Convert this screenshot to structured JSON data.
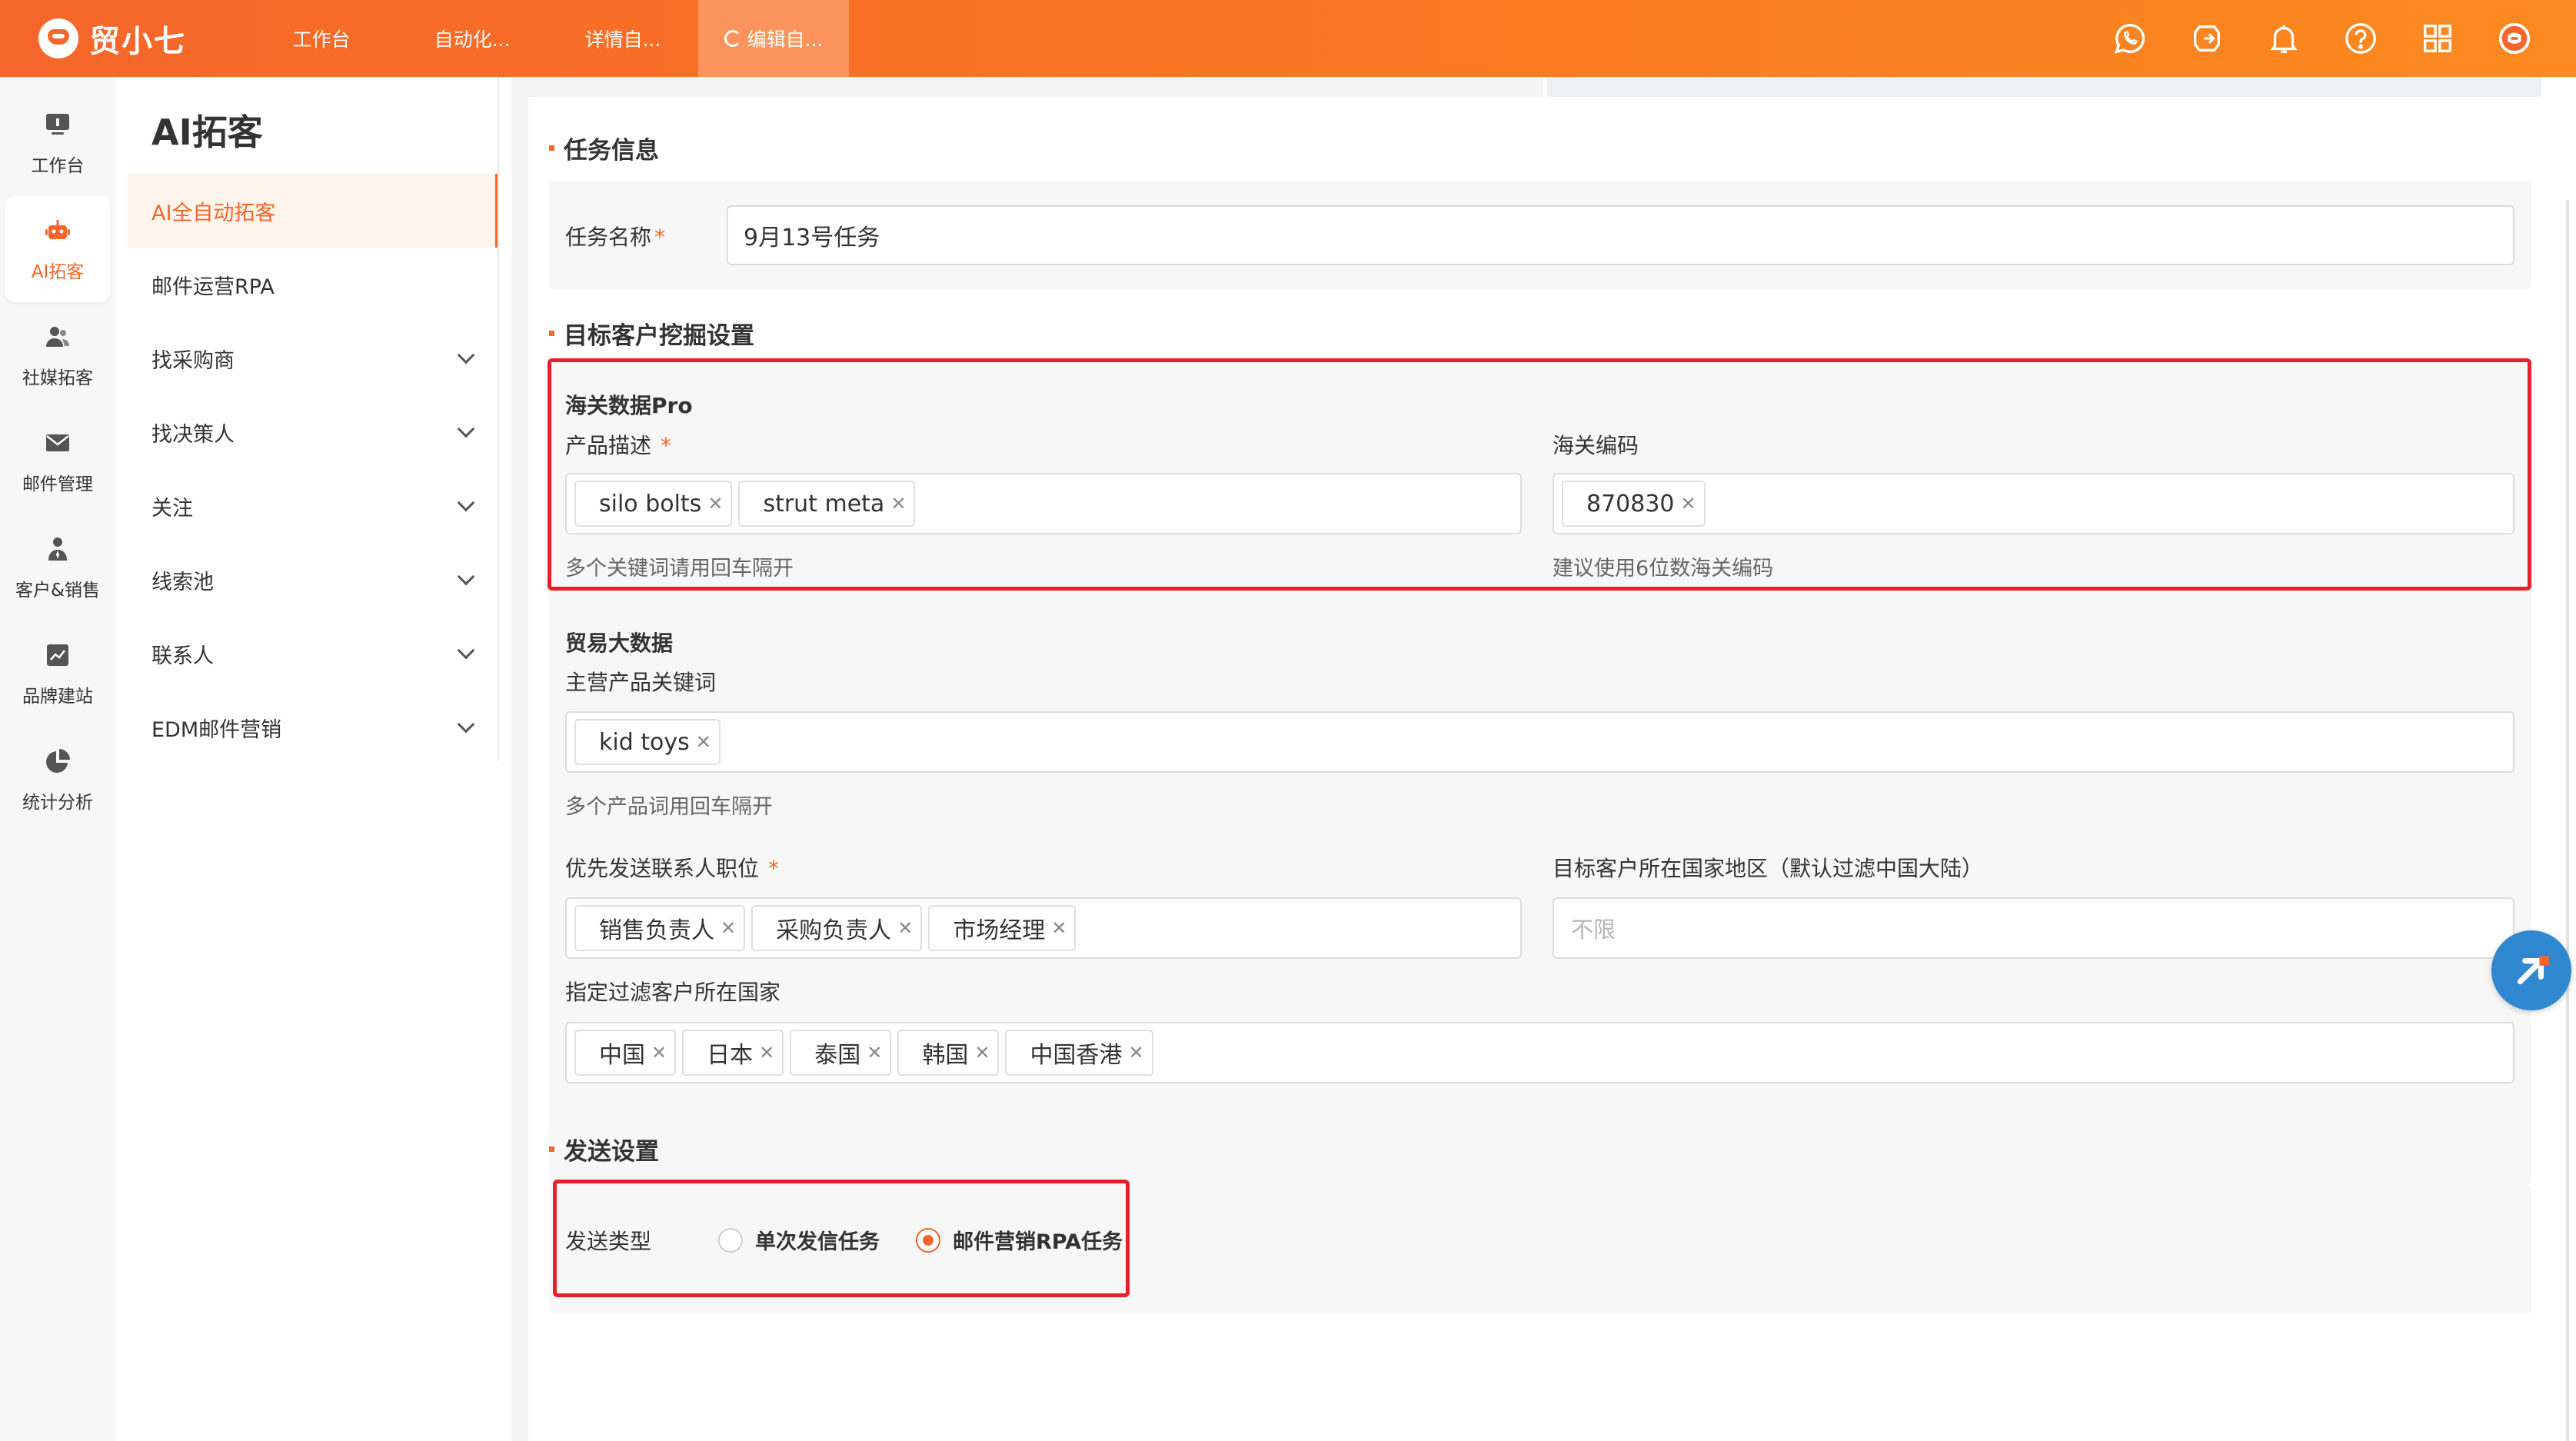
{
  "app": {
    "name": "贸小七"
  },
  "top_tabs": [
    {
      "label": "工作台"
    },
    {
      "label": "自动化..."
    },
    {
      "label": "详情自..."
    },
    {
      "label": "编辑自..."
    }
  ],
  "top_icons": [
    "whatsapp-icon",
    "share-icon",
    "bell-icon",
    "help-icon",
    "apps-grid-icon",
    "user-avatar-icon"
  ],
  "rail": [
    {
      "label": "工作台",
      "icon": "monitor-icon"
    },
    {
      "label": "AI拓客",
      "icon": "robot-icon"
    },
    {
      "label": "社媒拓客",
      "icon": "users-icon"
    },
    {
      "label": "邮件管理",
      "icon": "mail-icon"
    },
    {
      "label": "客户&销售",
      "icon": "person-icon"
    },
    {
      "label": "品牌建站",
      "icon": "chart-board-icon"
    },
    {
      "label": "统计分析",
      "icon": "pie-chart-icon"
    }
  ],
  "subnav": {
    "title": "AI拓客",
    "items": [
      {
        "label": "AI全自动拓客"
      },
      {
        "label": "邮件运营RPA"
      },
      {
        "label": "找采购商"
      },
      {
        "label": "找决策人"
      },
      {
        "label": "关注"
      },
      {
        "label": "线索池"
      },
      {
        "label": "联系人"
      },
      {
        "label": "EDM邮件营销"
      }
    ]
  },
  "task_info": {
    "section_title": "任务信息",
    "name_label": "任务名称",
    "required_mark": "*",
    "name_value": "9月13号任务"
  },
  "target": {
    "section_title": "目标客户挖掘设置",
    "customs": {
      "title": "海关数据Pro",
      "product_label": "产品描述",
      "product_tags": [
        "silo bolts",
        "strut meta"
      ],
      "product_hint": "多个关键词请用回车隔开",
      "hs_label": "海关编码",
      "hs_tags": [
        "870830"
      ],
      "hs_hint": "建议使用6位数海关编码"
    },
    "trade": {
      "title": "贸易大数据",
      "keywords_label": "主营产品关键词",
      "keywords_tags": [
        "kid toys"
      ],
      "keywords_hint": "多个产品词用回车隔开"
    },
    "positions_label": "优先发送联系人职位",
    "positions_tags": [
      "销售负责人",
      "采购负责人",
      "市场经理"
    ],
    "region_label": "目标客户所在国家地区（默认过滤中国大陆）",
    "region_placeholder": "不限",
    "exclude_label": "指定过滤客户所在国家",
    "exclude_tags": [
      "中国",
      "日本",
      "泰国",
      "韩国",
      "中国香港"
    ]
  },
  "send": {
    "section_title": "发送设置",
    "type_label": "发送类型",
    "options": [
      {
        "label": "单次发信任务",
        "selected": false
      },
      {
        "label": "邮件营销RPA任务",
        "selected": true
      }
    ]
  },
  "colors": {
    "brand": "#f6662a",
    "highlight": "#e8202a",
    "float_button": "#2f87cf"
  }
}
